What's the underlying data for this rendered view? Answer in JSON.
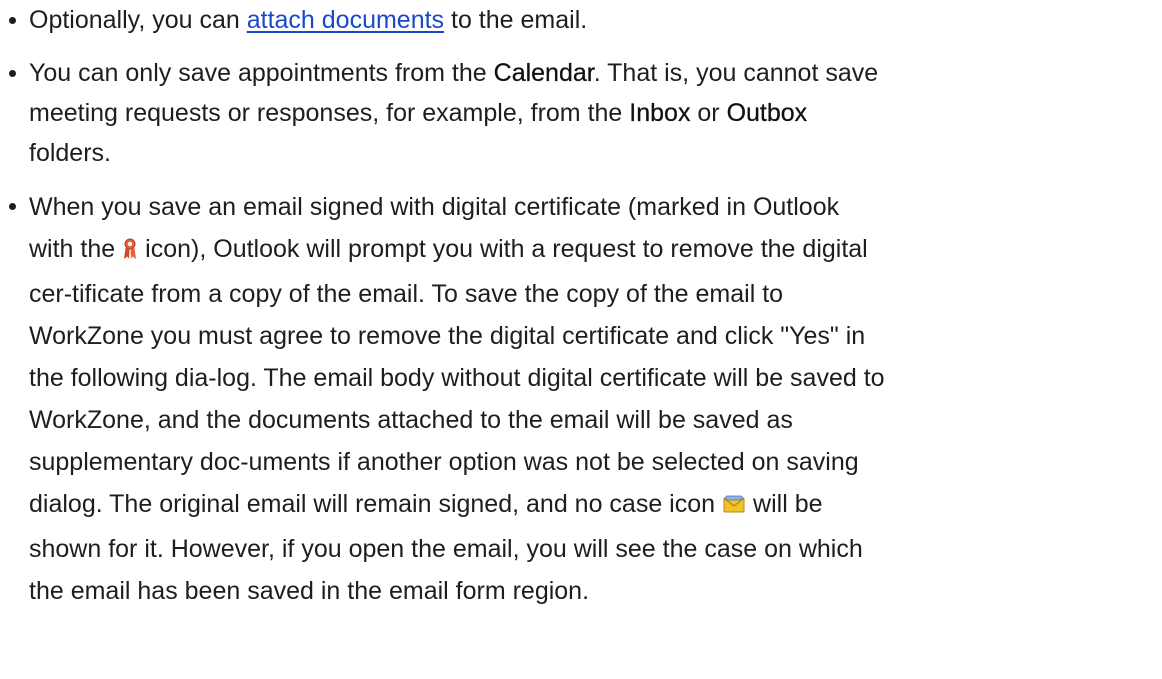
{
  "doc": {
    "item1": {
      "pre": "Optionally, you can ",
      "link": "attach documents",
      "post": " to the email."
    },
    "item2": {
      "p1": "You can only save appointments from the ",
      "calendar": "Calendar",
      "p2": ". That is, you cannot save meeting requests or responses, for example, from the ",
      "inbox": "Inbox",
      "p3": " or ",
      "outbox": "Outbox",
      "p4": " folders."
    },
    "item3": {
      "p1": "When you save an email signed with digital certificate (marked in Outlook with the",
      "p2": "icon), Outlook will prompt you with a request to remove the digital cer-tificate from a copy of the email. To save the copy of the email to WorkZone you must agree to remove the digital certificate and click \"Yes\" in the following dia-log. The email body without digital certificate will be saved to WorkZone, and the documents attached to the email will be saved as supplementary doc-uments if another option was not be selected on saving dialog. The original email will remain signed, and no case icon",
      "p3": "will be shown for it. However, if you open the email, you will see the case on which the email has been saved in the email form region."
    }
  },
  "icons": {
    "certificate": "certificate-ribbon-icon",
    "case": "case-envelope-icon"
  }
}
